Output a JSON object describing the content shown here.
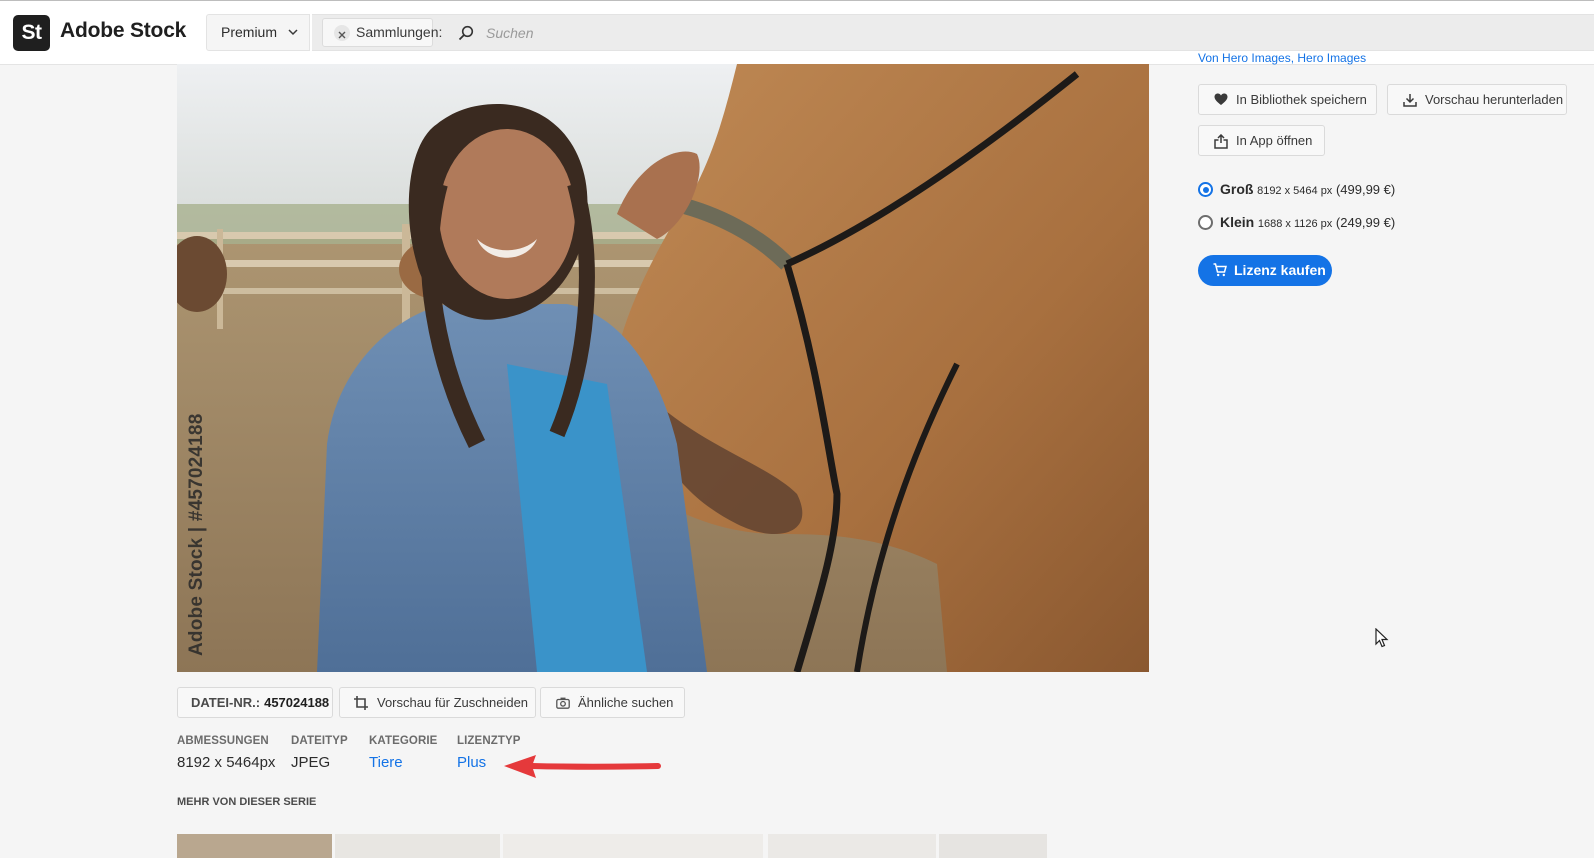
{
  "header": {
    "logo_mark": "St",
    "logo_text": "Adobe Stock",
    "plan_select": "Premium",
    "collection_chip": "Sammlungen:",
    "search_placeholder": "Suchen"
  },
  "image": {
    "watermark": "Adobe Stock | #457024188"
  },
  "toolbar": {
    "file_id_label": "DATEI-NR.:",
    "file_id_value": "457024188",
    "crop_preview": "Vorschau für Zuschneiden",
    "find_similar": "Ähnliche suchen"
  },
  "details": {
    "dimensions_label": "ABMESSUNGEN",
    "dimensions_value": "8192 x 5464px",
    "filetype_label": "DATEITYP",
    "filetype_value": "JPEG",
    "category_label": "KATEGORIE",
    "category_value": "Tiere",
    "license_label": "LIZENZTYP",
    "license_value": "Plus"
  },
  "series": {
    "title": "MEHR VON DIESER SERIE"
  },
  "sidebar": {
    "attribution": "Von Hero Images, Hero Images",
    "save_library": "In Bibliothek speichern",
    "download_preview": "Vorschau herunterladen",
    "open_in_app": "In App öffnen",
    "sizes": [
      {
        "name": "Groß",
        "dims": "8192 x 5464 px",
        "price": "(499,99 €)",
        "selected": true
      },
      {
        "name": "Klein",
        "dims": "1688 x 1126 px",
        "price": "(249,99 €)",
        "selected": false
      }
    ],
    "buy_license": "Lizenz kaufen"
  },
  "colors": {
    "accent": "#1473e6",
    "annotation_arrow": "#e5393b"
  }
}
